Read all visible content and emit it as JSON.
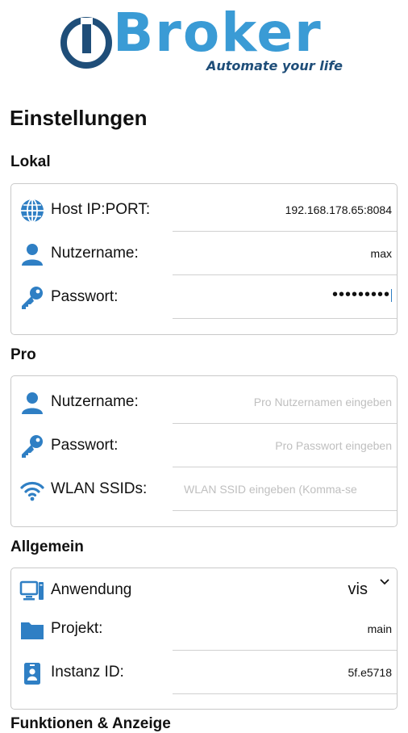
{
  "brand": {
    "logo_text": "Broker",
    "tagline": "Automate your life",
    "logo_color": "#3a9bd5",
    "logo_dark": "#1f4e79"
  },
  "page": {
    "title": "Einstellungen"
  },
  "sections": {
    "lokal": {
      "title": "Lokal",
      "rows": [
        {
          "label": "Host IP:PORT:",
          "value": "192.168.178.65:8084",
          "icon": "globe-icon"
        },
        {
          "label": "Nutzername:",
          "value": "max",
          "icon": "user-icon"
        },
        {
          "label": "Passwort:",
          "value": "•••••••••",
          "icon": "key-icon"
        }
      ]
    },
    "pro": {
      "title": "Pro",
      "rows": [
        {
          "label": "Nutzername:",
          "placeholder": "Pro Nutzernamen eingeben",
          "icon": "user-icon"
        },
        {
          "label": "Passwort:",
          "placeholder": "Pro Passwort eingeben",
          "icon": "key-icon"
        },
        {
          "label": "WLAN SSIDs:",
          "placeholder": "WLAN SSID eingeben (Komma-se",
          "icon": "wifi-icon"
        }
      ]
    },
    "allgemein": {
      "title": "Allgemein",
      "rows": [
        {
          "label": "Anwendung",
          "value": "vis",
          "icon": "computer-icon"
        },
        {
          "label": "Projekt:",
          "value": "main",
          "icon": "folder-icon"
        },
        {
          "label": "Instanz ID:",
          "value": "5f.e5718",
          "icon": "id-badge-icon"
        }
      ]
    },
    "next_partial": {
      "title": "Funktionen & Anzeige"
    }
  },
  "colors": {
    "icon_blue": "#2f7fc4",
    "placeholder": "#bfbfbf",
    "border": "#c9c9c9"
  }
}
